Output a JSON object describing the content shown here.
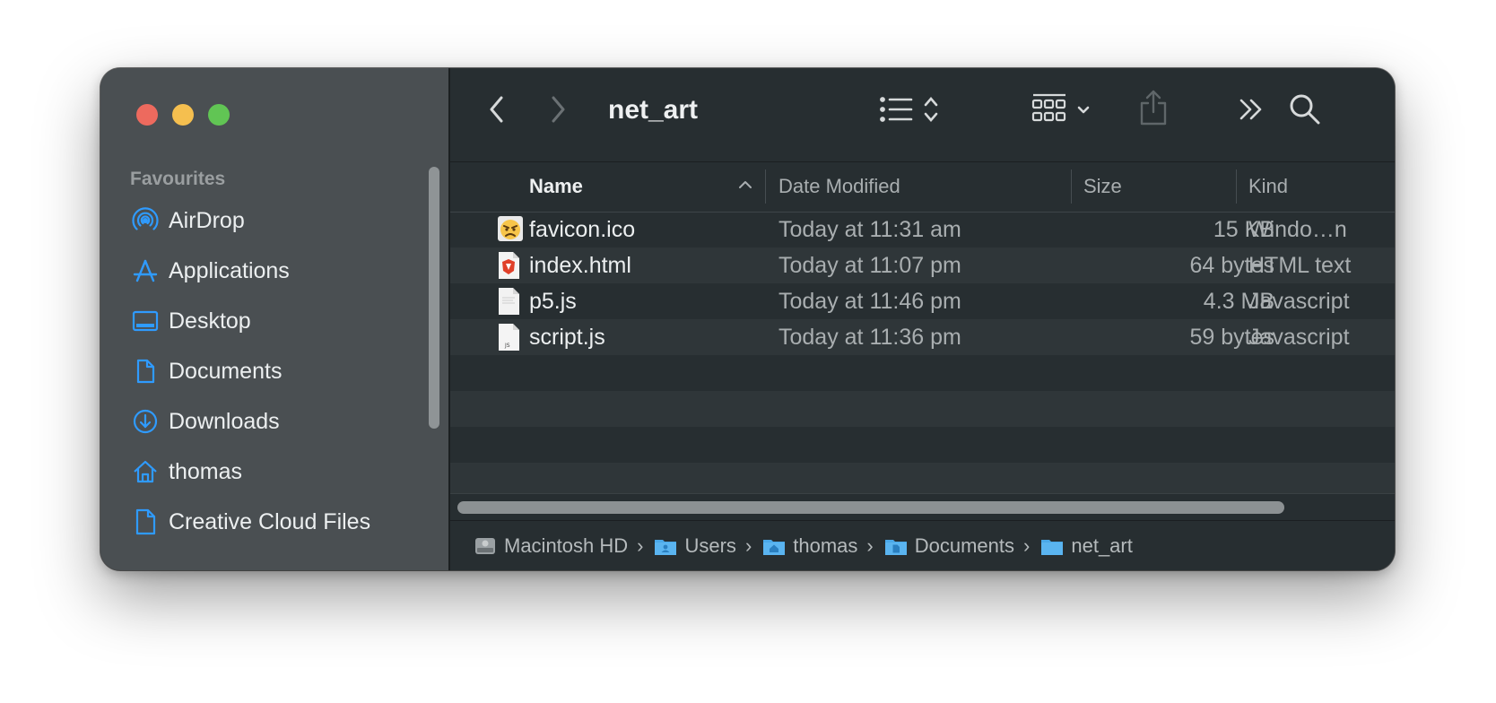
{
  "window": {
    "title": "net_art",
    "traffic_lights": [
      "close",
      "minimize",
      "maximize"
    ]
  },
  "sidebar": {
    "heading": "Favourites",
    "items": [
      {
        "label": "AirDrop",
        "icon": "airdrop-icon"
      },
      {
        "label": "Applications",
        "icon": "applications-icon"
      },
      {
        "label": "Desktop",
        "icon": "desktop-icon"
      },
      {
        "label": "Documents",
        "icon": "document-icon"
      },
      {
        "label": "Downloads",
        "icon": "download-icon"
      },
      {
        "label": "thomas",
        "icon": "home-icon"
      },
      {
        "label": "Creative Cloud Files",
        "icon": "file-icon"
      }
    ]
  },
  "toolbar": {
    "back": "chevron-left-icon",
    "forward": "chevron-right-icon",
    "view_mode": "list-view-icon",
    "group": "grid-group-icon",
    "share": "share-icon",
    "more": "double-chevron-icon",
    "search": "search-icon"
  },
  "columns": {
    "name": "Name",
    "date": "Date Modified",
    "size": "Size",
    "kind": "Kind",
    "sort_column": "Name",
    "sort_direction": "ascending"
  },
  "files": [
    {
      "name": "favicon.ico",
      "date": "Today at 11:31 am",
      "size": "15 KB",
      "kind": "Windo…n",
      "icon": "ico-file-icon"
    },
    {
      "name": "index.html",
      "date": "Today at 11:07 pm",
      "size": "64 bytes",
      "kind": "HTML text",
      "icon": "html-file-icon"
    },
    {
      "name": "p5.js",
      "date": "Today at 11:46 pm",
      "size": "4.3 MB",
      "kind": "Javascript",
      "icon": "js-file-icon"
    },
    {
      "name": "script.js",
      "date": "Today at 11:36 pm",
      "size": "59 bytes",
      "kind": "Javascript",
      "icon": "js-file-icon"
    }
  ],
  "pathbar": [
    {
      "label": "Macintosh HD",
      "icon": "hard-drive-icon"
    },
    {
      "label": "Users",
      "icon": "users-folder-icon"
    },
    {
      "label": "thomas",
      "icon": "home-folder-icon"
    },
    {
      "label": "Documents",
      "icon": "documents-folder-icon"
    },
    {
      "label": "net_art",
      "icon": "folder-icon"
    }
  ],
  "colors": {
    "accent": "#2f9bff",
    "sidebar_bg": "#4a4f52",
    "content_bg": "#272e31",
    "row_alt_bg": "#2f3639",
    "close": "#ed6a5e",
    "minimize": "#f5bf4f",
    "maximize": "#61c554"
  }
}
